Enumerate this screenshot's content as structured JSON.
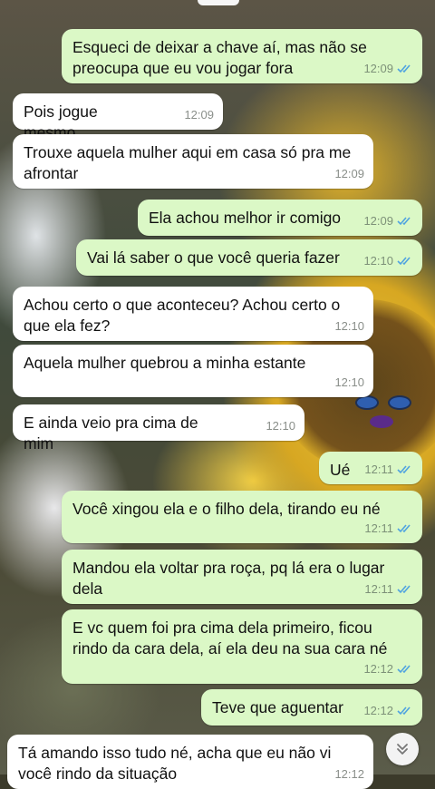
{
  "messages": [
    {
      "dir": "out",
      "text": "Esqueci de deixar a chave aí, mas não se preocupa que eu vou jogar fora",
      "time": "12:09",
      "read": true
    },
    {
      "dir": "in",
      "text": "Pois jogue mesmo",
      "time": "12:09"
    },
    {
      "dir": "in",
      "text": "Trouxe aquela mulher aqui em casa só pra me afrontar",
      "time": "12:09"
    },
    {
      "dir": "out",
      "text": "Ela achou melhor ir comigo",
      "time": "12:09",
      "read": true
    },
    {
      "dir": "out",
      "text": "Vai lá saber o que você queria fazer",
      "time": "12:10",
      "read": true
    },
    {
      "dir": "in",
      "text": "Achou certo o que aconteceu? Achou certo o que ela fez?",
      "time": "12:10"
    },
    {
      "dir": "in",
      "text": "Aquela mulher quebrou a minha estante",
      "time": "12:10"
    },
    {
      "dir": "in",
      "text": "E ainda veio pra cima de mim",
      "time": "12:10"
    },
    {
      "dir": "out",
      "text": "Ué",
      "time": "12:11",
      "read": true
    },
    {
      "dir": "out",
      "text": "Você xingou ela e o filho dela, tirando eu né",
      "time": "12:11",
      "read": true
    },
    {
      "dir": "out",
      "text": "Mandou ela voltar pra roça, pq lá era o lugar dela",
      "time": "12:11",
      "read": true
    },
    {
      "dir": "out",
      "text": "E vc quem foi pra cima dela primeiro, ficou rindo da cara dela, aí ela deu na sua cara né",
      "time": "12:12",
      "read": true
    },
    {
      "dir": "out",
      "text": "Teve que aguentar",
      "time": "12:12",
      "read": true
    },
    {
      "dir": "in",
      "text": "Tá amando isso tudo né, acha que eu não vi você rindo da situação",
      "time": "12:12"
    }
  ],
  "icons": {
    "read_receipt": "double-check-icon",
    "scroll_down": "double-chevron-down-icon"
  },
  "colors": {
    "outgoing_bubble": "#dbf8c6",
    "incoming_bubble": "#ffffff",
    "read_check": "#4fa3e0"
  }
}
